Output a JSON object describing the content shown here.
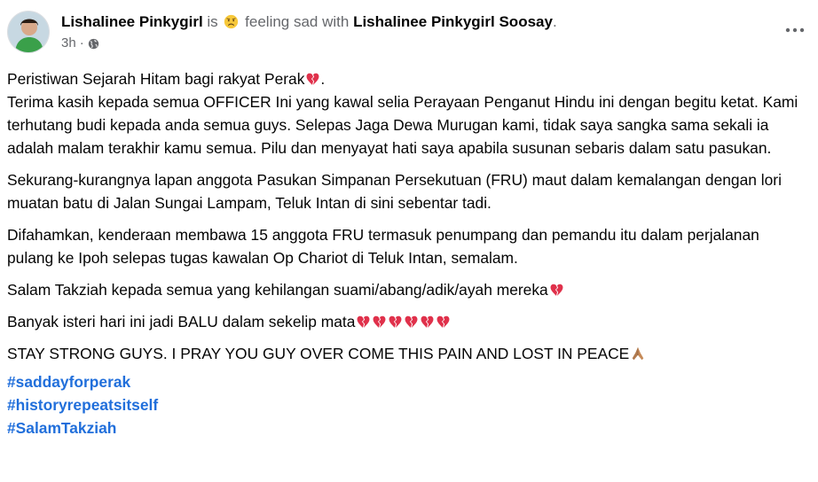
{
  "header": {
    "actor_name": "Lishalinee Pinkygirl",
    "is_text": "is",
    "feeling_icon": "sad-face-emoji",
    "feeling_text": "feeling sad with",
    "tagged_name": "Lishalinee Pinkygirl Soosay",
    "tagged_suffix": ".",
    "timestamp": "3h",
    "separator": "·",
    "audience_icon": "globe-icon",
    "more_icon": "more-options-icon"
  },
  "body": {
    "line1": "Peristiwan Sejarah Hitam bagi rakyat Perak",
    "line1_end": ".",
    "para1": "Terima kasih kepada semua OFFICER Ini yang kawal selia Perayaan Penganut Hindu ini dengan begitu ketat. Kami terhutang budi kepada anda semua guys. Selepas Jaga Dewa Murugan kami, tidak saya sangka sama sekali ia  adalah malam terakhir kamu semua. Pilu dan menyayat hati saya apabila susunan sebaris dalam satu pasukan.",
    "para2": "Sekurang-kurangnya lapan anggota Pasukan Simpanan Persekutuan (FRU) maut dalam kemalangan dengan lori muatan batu di Jalan Sungai Lampam, Teluk Intan di sini sebentar tadi.",
    "para3": "Difahamkan, kenderaan membawa 15 anggota FRU termasuk penumpang dan pemandu itu dalam perjalanan pulang ke Ipoh selepas tugas kawalan Op Chariot di Teluk Intan, semalam.",
    "para4": "Salam Takziah kepada semua yang kehilangan suami/abang/adik/ayah mereka",
    "para5": "Banyak isteri hari ini jadi BALU dalam sekelip mata",
    "para6": "STAY STRONG GUYS. I PRAY YOU GUY OVER COME THIS PAIN AND LOST IN PEACE",
    "emoji_icons": [
      "broken-heart-emoji",
      "folded-hands-emoji"
    ]
  },
  "hashtags": [
    "#saddayforperak",
    "#historyrepeatsitself",
    "#SalamTakziah"
  ],
  "colors": {
    "text": "#050505",
    "muted": "#65676b",
    "link": "#216fdb",
    "heart": "#e0314b"
  }
}
